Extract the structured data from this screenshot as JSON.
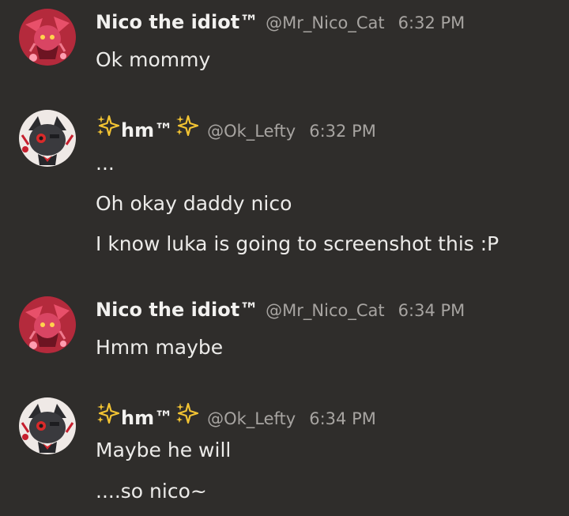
{
  "messages": [
    {
      "author": "Nico the idiot™",
      "handle": "@Mr_Nico_Cat",
      "time": "6:32 PM",
      "avatar": "red-character-avatar",
      "lines": [
        "Ok mommy"
      ]
    },
    {
      "author_prefix_icon": "sparkles-icon",
      "author": "hm™",
      "author_suffix_icon": "sparkles-icon",
      "handle": "@Ok_Lefty",
      "time": "6:32 PM",
      "avatar": "dark-cat-avatar",
      "lines": [
        "...",
        "Oh okay daddy nico",
        "I know luka is going to screenshot this :P"
      ]
    },
    {
      "author": "Nico the idiot™",
      "handle": "@Mr_Nico_Cat",
      "time": "6:34 PM",
      "avatar": "red-character-avatar",
      "lines": [
        "Hmm maybe"
      ]
    },
    {
      "author_prefix_icon": "sparkles-icon",
      "author": "hm™",
      "author_suffix_icon": "sparkles-icon",
      "handle": "@Ok_Lefty",
      "time": "6:34 PM",
      "avatar": "dark-cat-avatar",
      "lines": [
        "Maybe he will",
        "....so nico~"
      ]
    }
  ],
  "colors": {
    "background": "#2f2d2b",
    "text": "#ecebe9",
    "muted": "#a7a4a1",
    "sparkle": "#f3c433"
  }
}
